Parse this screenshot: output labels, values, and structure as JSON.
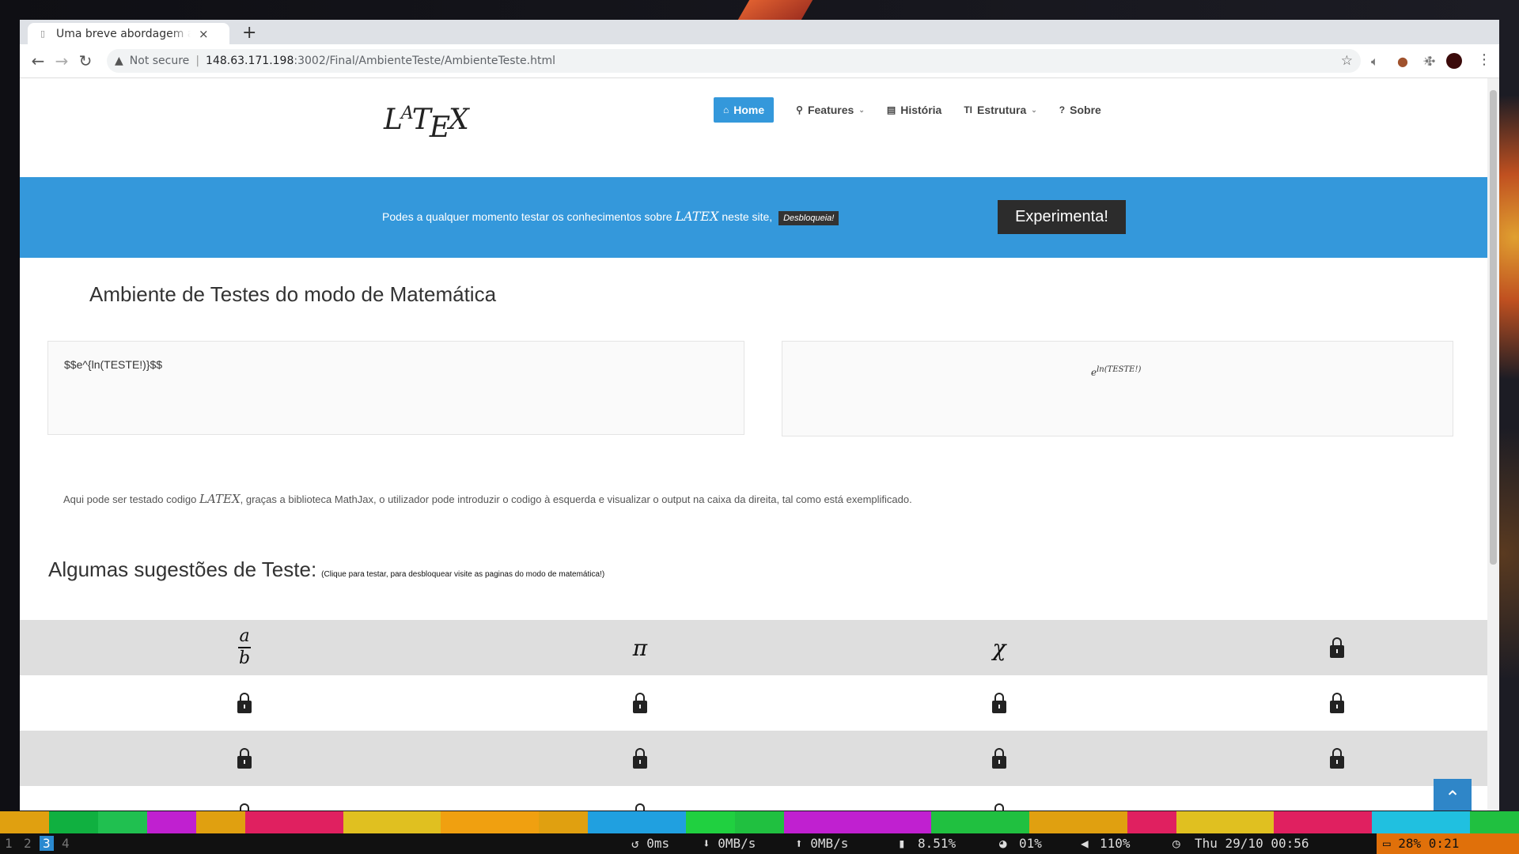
{
  "browser": {
    "tab_title": "Uma breve abordagem ao",
    "tab_close": "×",
    "new_tab": "+",
    "not_secure": "Not secure",
    "url_host": "148.63.171.198",
    "url_path": ":3002/Final/AmbienteTeste/AmbienteTeste.html"
  },
  "site": {
    "logo": {
      "l": "L",
      "a": "A",
      "t": "T",
      "e": "E",
      "x": "X"
    },
    "nav": [
      {
        "label": "Home",
        "icon": "home-icon"
      },
      {
        "label": "Features",
        "icon": "search-icon"
      },
      {
        "label": "História",
        "icon": "book-icon"
      },
      {
        "label": "Estrutura",
        "icon": "text-height-icon"
      },
      {
        "label": "Sobre",
        "icon": "question-circle-icon"
      }
    ],
    "banner": {
      "text_before": "Podes a qualquer momento testar os conhecimentos sobre",
      "latex": "LATEX",
      "text_after": "neste site,",
      "badge": "Desbloqueia!",
      "cta": "Experimenta!"
    },
    "heading": "Ambiente de Testes do modo de Matemática",
    "input_code": "$$e^{ln(TESTE!)}$$",
    "output": {
      "base": "e",
      "exponent": "ln(TESTE!)"
    },
    "description": {
      "before": "Aqui pode ser testado codigo",
      "latex": "LATEX",
      "after": ", graças a biblioteca MathJax, o utilizador pode introduzir o codigo à esquerda e visualizar o output na caixa da direita, tal como está exemplificado."
    },
    "suggestions": {
      "title": "Algumas sugestões de Teste:",
      "note": "(Clique para testar, para desbloquear visite as paginas do modo de matemática!)",
      "row1": {
        "frac_num": "a",
        "frac_den": "b",
        "pi": "π",
        "chi": "χ"
      }
    }
  },
  "statusbar": {
    "workspaces": [
      "1",
      "2",
      "3",
      "4"
    ],
    "active_workspace": "3",
    "latency": "↺ 0ms",
    "down": "⬇ 0MB/s",
    "up": "⬆ 0MB/s",
    "mem": "8.51%",
    "cpu": "01%",
    "volume": "110%",
    "clock": "Thu 29/10 00:56",
    "battery": "28% 0:21"
  },
  "colors": {
    "accent": "#3498db",
    "strip": [
      "#e0a010",
      "#10b040",
      "#20c050",
      "#c020d0",
      "#e0a010",
      "#e02060",
      "#e02060",
      "#e0c020",
      "#e0c020",
      "#f0a010",
      "#f0a010",
      "#e0a010",
      "#20a0e0",
      "#20a0e0",
      "#20d040",
      "#20c040",
      "#c020d0",
      "#c020d0",
      "#c020d0",
      "#20c040",
      "#20c040",
      "#e0a010",
      "#e0a010",
      "#e02060",
      "#e0c020",
      "#e0c020",
      "#e02060",
      "#e02060",
      "#20c0e0",
      "#20c0e0",
      "#20c040"
    ]
  }
}
